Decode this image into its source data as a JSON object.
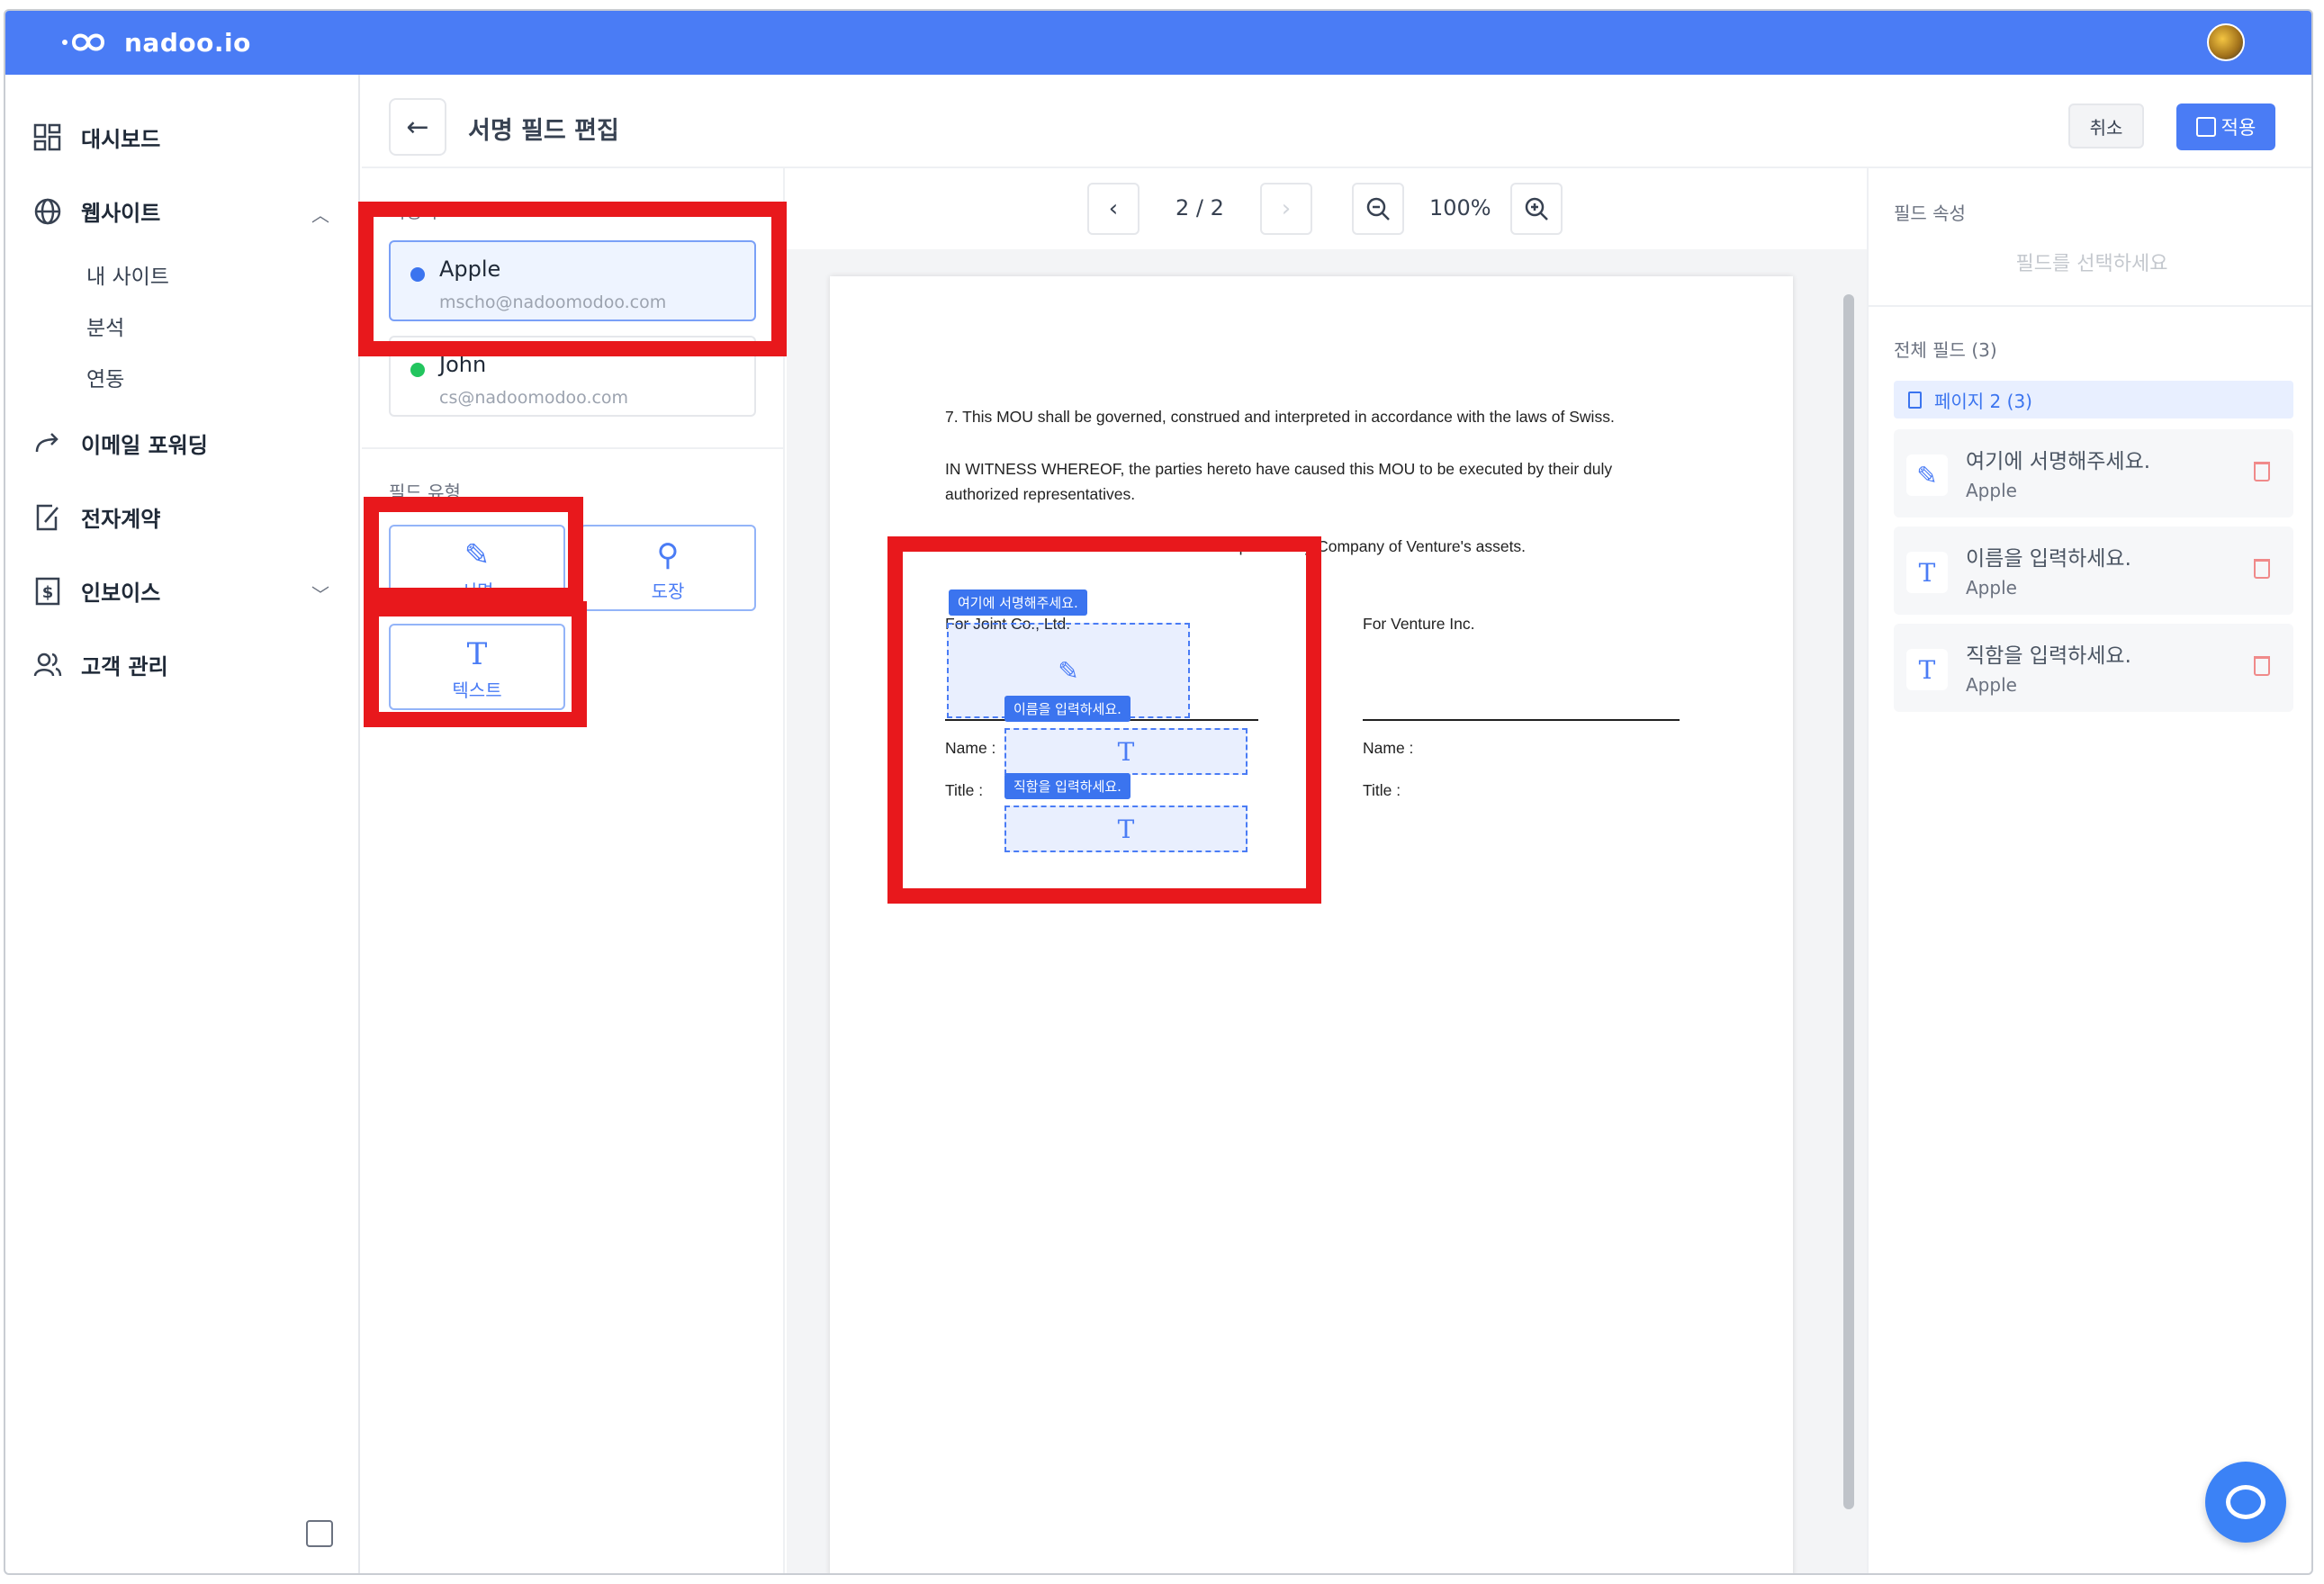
{
  "brand": {
    "name": "nadoo.io"
  },
  "sidebar": {
    "items": [
      {
        "label": "대시보드"
      },
      {
        "label": "웹사이트"
      },
      {
        "label": "이메일 포워딩"
      },
      {
        "label": "전자계약"
      },
      {
        "label": "인보이스"
      },
      {
        "label": "고객 관리"
      }
    ],
    "website_sub": [
      "내 사이트",
      "분석",
      "연동"
    ]
  },
  "header": {
    "title": "서명 필드 편집",
    "cancel_label": "취소",
    "apply_label": "적용"
  },
  "signers": {
    "label": "서명자",
    "list": [
      {
        "name": "Apple",
        "email": "mscho@nadoomodoo.com",
        "color": "#3b74ef"
      },
      {
        "name": "John",
        "email": "cs@nadoomodoo.com",
        "color": "#22c55e"
      }
    ]
  },
  "field_types": {
    "label": "필드 유형",
    "signature": "서명",
    "stamp": "도장",
    "text": "텍스트"
  },
  "viewer": {
    "page_indicator": "2 / 2",
    "zoom": "100%"
  },
  "document": {
    "clause7": "7. This MOU shall be governed, construed and interpreted in accordance with the laws of Swiss.",
    "witness_1": "IN WITNESS WHEREOF, the parties hereto have caused this MOU to be executed by their duly",
    "witness_2": "authorized representatives.",
    "exhibit": "Exhibit A : The terms and conditions of acquisition by Company of Venture's assets.",
    "party_left": "For Joint Co., Ltd.",
    "party_right": "For Venture Inc.",
    "name_label": "Name :",
    "title_label": "Title :",
    "field_tags": {
      "signature": "여기에 서명해주세요.",
      "name": "이름을 입력하세요.",
      "title": "직함을 입력하세요."
    }
  },
  "properties": {
    "label": "필드 속성",
    "placeholder": "필드를 선택하세요",
    "all_fields_label": "전체 필드 (3)",
    "page_group": "페이지 2 (3)",
    "fields": [
      {
        "title": "여기에 서명해주세요.",
        "signer": "Apple",
        "icon": "pencil-icon"
      },
      {
        "title": "이름을 입력하세요.",
        "signer": "Apple",
        "icon": "text-icon"
      },
      {
        "title": "직함을 입력하세요.",
        "signer": "Apple",
        "icon": "text-icon"
      }
    ]
  },
  "colors": {
    "brand_blue": "#4a7cf5",
    "annotation_red": "#e8181c"
  }
}
